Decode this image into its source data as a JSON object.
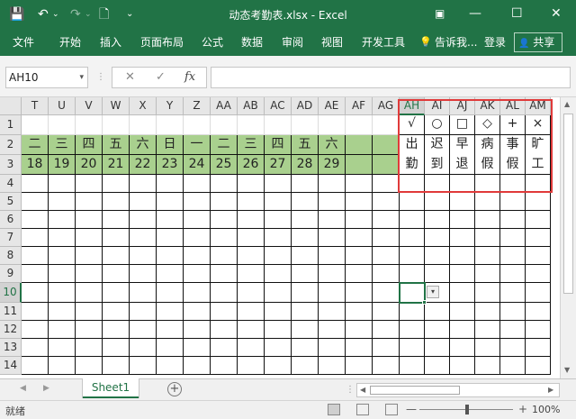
{
  "titlebar": {
    "title": "动态考勤表.xlsx - Excel",
    "save_glyph": "💾",
    "undo_glyph": "↶",
    "redo_glyph": "↷",
    "newfile_glyph": "🗋",
    "more_glyph": "⌄",
    "ribbon_opts_glyph": "▣",
    "min_glyph": "—",
    "max_glyph": "☐",
    "close_glyph": "✕"
  },
  "ribbon": {
    "tabs": [
      "文件",
      "开始",
      "插入",
      "页面布局",
      "公式",
      "数据",
      "审阅",
      "视图",
      "开发工具"
    ],
    "tell_me": "告诉我...",
    "tell_icon": "💡",
    "signin": "登录",
    "share": "共享",
    "share_icon": "👤"
  },
  "formula_bar": {
    "name_box": "AH10",
    "dropdown_glyph": "▾",
    "dots": "⋮",
    "cancel_glyph": "✕",
    "enter_glyph": "✓",
    "fx_label": "fx",
    "formula": ""
  },
  "grid": {
    "columns": [
      "T",
      "U",
      "V",
      "W",
      "X",
      "Y",
      "Z",
      "AA",
      "AB",
      "AC",
      "AD",
      "AE",
      "AF",
      "AG",
      "AH",
      "AI",
      "AJ",
      "AK",
      "AL",
      "AM"
    ],
    "rows": [
      "1",
      "2",
      "3",
      "4",
      "5",
      "6",
      "7",
      "8",
      "9",
      "10",
      "11",
      "12",
      "13",
      "14"
    ],
    "selected_column": "AH",
    "selected_row": "10",
    "weekdays": [
      "二",
      "三",
      "四",
      "五",
      "六",
      "日",
      "一",
      "二",
      "三",
      "四",
      "五",
      "六"
    ],
    "days": [
      "18",
      "19",
      "20",
      "21",
      "22",
      "23",
      "24",
      "25",
      "26",
      "27",
      "28",
      "29"
    ],
    "legend_symbols": [
      "√",
      "○",
      "□",
      "◇",
      "+",
      "×"
    ],
    "legend_top": [
      "出",
      "迟",
      "早",
      "病",
      "事",
      "旷"
    ],
    "legend_bottom": [
      "勤",
      "到",
      "退",
      "假",
      "假",
      "工"
    ],
    "dropdown_glyph": "▾"
  },
  "sheet_tabs": {
    "nav_prev": "◀",
    "nav_next": "▶",
    "active": "Sheet1",
    "add_glyph": "+",
    "separator": "⋮",
    "scroll_left": "◀",
    "scroll_right": "▶"
  },
  "scrollbar": {
    "up": "▲",
    "down": "▼"
  },
  "status_bar": {
    "ready": "就绪",
    "zoom_out": "—",
    "zoom_in": "+",
    "zoom": "100%"
  },
  "colors": {
    "excel_green": "#217346",
    "header_fill": "#a9d08e",
    "highlight_box": "#e03a3a"
  }
}
